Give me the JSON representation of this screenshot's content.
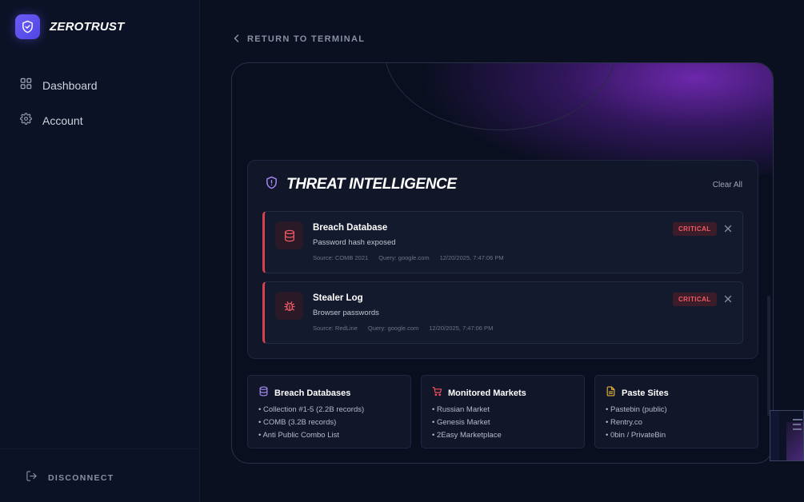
{
  "brand": {
    "name": "ZEROTRUST",
    "logo_icon": "shield-check-icon",
    "accent": "#5b4ef0"
  },
  "sidebar": {
    "items": [
      {
        "label": "Dashboard",
        "icon": "grid-icon"
      },
      {
        "label": "Account",
        "icon": "gear-icon"
      }
    ],
    "disconnect_label": "DISCONNECT",
    "disconnect_icon": "logout-icon"
  },
  "header": {
    "return_label": "RETURN TO TERMINAL"
  },
  "threat_intel": {
    "title": "THREAT INTELLIGENCE",
    "clear_label": "Clear All",
    "alerts": [
      {
        "title": "Breach Database",
        "description": "Password hash exposed",
        "source": "Source: COMB 2021",
        "query": "Query: google.com",
        "time": "12/20/2025, 7:47:06 PM",
        "severity": "CRITICAL",
        "icon": "database-icon"
      },
      {
        "title": "Stealer Log",
        "description": "Browser passwords",
        "source": "Source: RedLine",
        "query": "Query: google.com",
        "time": "12/20/2025, 7:47:06 PM",
        "severity": "CRITICAL",
        "icon": "bug-icon"
      }
    ]
  },
  "cards": [
    {
      "title": "Breach Databases",
      "icon": "database-icon",
      "icon_color": "#a78bfa",
      "items": [
        "• Collection #1-5 (2.2B records)",
        "• COMB (3.2B records)",
        "• Anti Public Combo List"
      ]
    },
    {
      "title": "Monitored Markets",
      "icon": "cart-icon",
      "icon_color": "#ef4f5d",
      "items": [
        "• Russian Market",
        "• Genesis Market",
        "• 2Easy Marketplace"
      ]
    },
    {
      "title": "Paste Sites",
      "icon": "document-icon",
      "icon_color": "#e8b339",
      "items": [
        "• Pastebin (public)",
        "• Rentry.co",
        "• 0bin / PrivateBin"
      ]
    }
  ],
  "colors": {
    "critical": "#f05a66",
    "background": "#0b1021",
    "panel_glow": "#7e2cc4"
  }
}
